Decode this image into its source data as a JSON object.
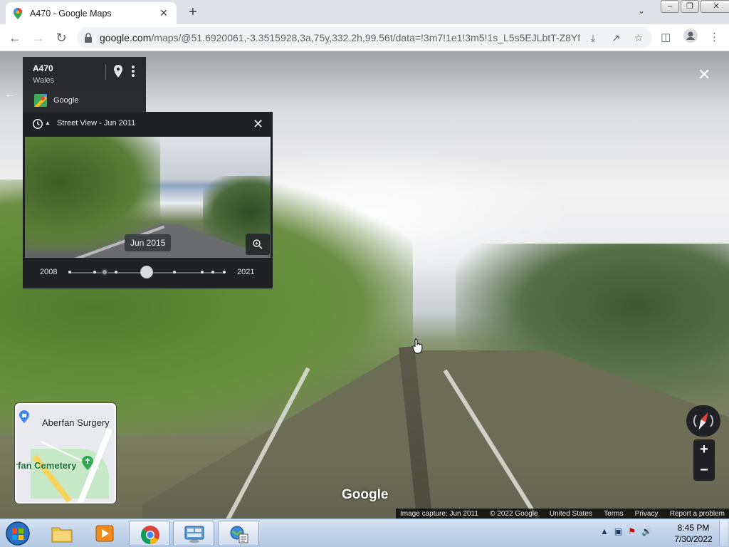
{
  "browser": {
    "tab_title": "A470 - Google Maps",
    "tab_close": "✕",
    "new_tab": "+",
    "url_host": "google.com",
    "url_path": "/maps/@51.6920061,-3.3515928,3a,75y,332.2h,99.56t/data=!3m7!1e1!3m5!1s_L5s5EJLbtT-Z8Yf..."
  },
  "streetview": {
    "location_title": "A470",
    "location_region": "Wales",
    "provider": "Google",
    "time_machine": {
      "title": "Street View - Jun 2011",
      "preview_date": "Jun 2015",
      "year_start": "2008",
      "year_end": "2021"
    },
    "minimap": {
      "label_surgery": "Aberfan Surgery",
      "label_cemetery": "rfan Cemetery"
    },
    "watermark": "Google",
    "zoom_in": "+",
    "zoom_out": "−",
    "attribution": {
      "capture": "Image capture: Jun 2011",
      "copyright": "© 2022 Google",
      "country": "United States",
      "terms": "Terms",
      "privacy": "Privacy",
      "report": "Report a problem"
    }
  },
  "taskbar": {
    "time": "8:45 PM",
    "date": "7/30/2022"
  }
}
